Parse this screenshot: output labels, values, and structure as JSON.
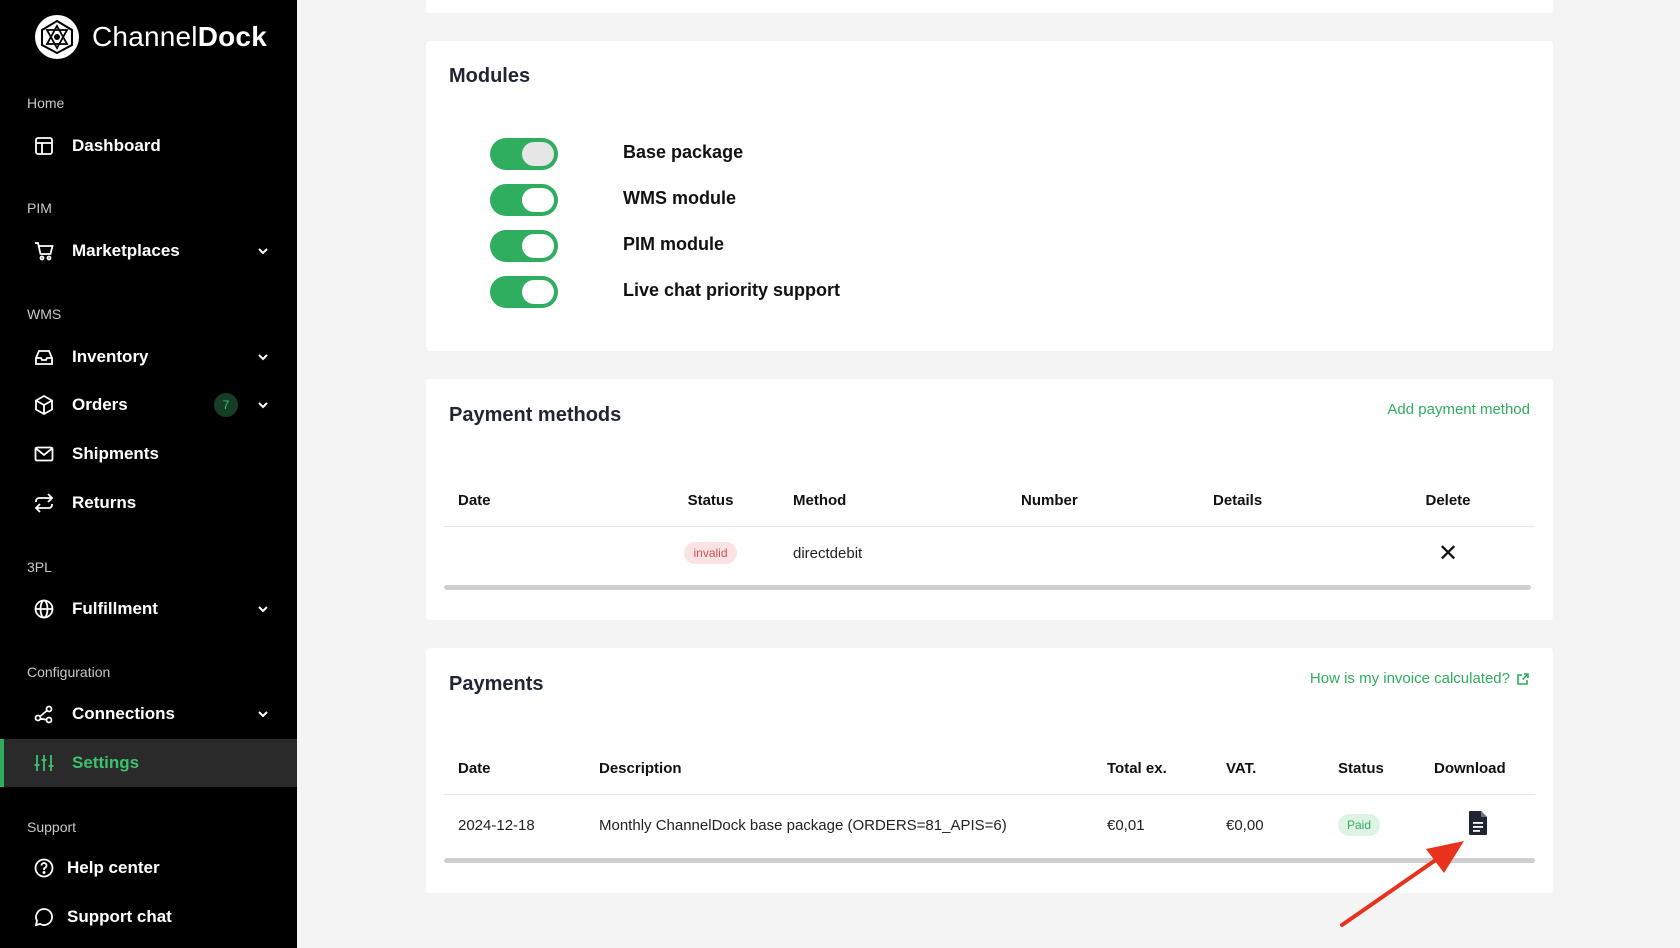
{
  "brand": {
    "name_light": "Channel",
    "name_bold": "Dock"
  },
  "sidebar": {
    "sections": [
      {
        "label": "Home"
      },
      {
        "label": "PIM"
      },
      {
        "label": "WMS"
      },
      {
        "label": "3PL"
      },
      {
        "label": "Configuration"
      },
      {
        "label": "Support"
      }
    ],
    "items": [
      {
        "label": "Dashboard",
        "icon": "dashboard-icon"
      },
      {
        "label": "Marketplaces",
        "icon": "cart-icon"
      },
      {
        "label": "Inventory",
        "icon": "inbox-icon"
      },
      {
        "label": "Orders",
        "icon": "box-icon",
        "badge": "7"
      },
      {
        "label": "Shipments",
        "icon": "mail-icon"
      },
      {
        "label": "Returns",
        "icon": "returns-icon"
      },
      {
        "label": "Fulfillment",
        "icon": "globe-icon"
      },
      {
        "label": "Connections",
        "icon": "share-icon"
      },
      {
        "label": "Settings",
        "icon": "sliders-icon",
        "active": true
      },
      {
        "label": "Help center",
        "icon": "help-icon"
      },
      {
        "label": "Support chat",
        "icon": "chat-icon"
      }
    ]
  },
  "modules": {
    "title": "Modules",
    "items": [
      {
        "label": "Base package",
        "enabled": true
      },
      {
        "label": "WMS module",
        "enabled": true
      },
      {
        "label": "PIM module",
        "enabled": true
      },
      {
        "label": "Live chat priority support",
        "enabled": true
      }
    ]
  },
  "payment_methods": {
    "title": "Payment methods",
    "add_link": "Add payment method",
    "columns": [
      "Date",
      "Status",
      "Method",
      "Number",
      "Details",
      "Delete"
    ],
    "rows": [
      {
        "date": "",
        "status": "invalid",
        "method": "directdebit",
        "number": "",
        "details": "",
        "delete": "✕"
      }
    ]
  },
  "payments": {
    "title": "Payments",
    "help_link": "How is my invoice calculated?",
    "columns": [
      "Date",
      "Description",
      "Total ex.",
      "VAT.",
      "Status",
      "Download"
    ],
    "rows": [
      {
        "date": "2024-12-18",
        "description": "Monthly ChannelDock base package (ORDERS=81_APIS=6)",
        "total": "€0,01",
        "vat": "€0,00",
        "status": "Paid"
      }
    ]
  },
  "colors": {
    "accent": "#2fae5f",
    "sidebar_bg": "#000000",
    "arrow": "#e8321e"
  }
}
